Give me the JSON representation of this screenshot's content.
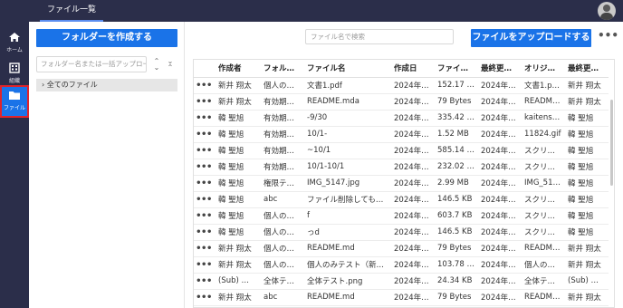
{
  "topbar": {
    "tab_label": "ファイル一覧"
  },
  "nav": {
    "items": [
      {
        "label": "ホーム",
        "icon": "home-icon"
      },
      {
        "label": "組織",
        "icon": "organization-icon"
      },
      {
        "label": "ファイル",
        "icon": "folder-icon",
        "active": true
      }
    ]
  },
  "folders": {
    "create_label": "フォルダーを作成する",
    "search_placeholder": "フォルダー名または一括アップロー",
    "tree_root": "全てのファイル"
  },
  "files": {
    "search_placeholder": "ファイル名で検索",
    "upload_label": "ファイルをアップロードする",
    "more_label": "•••",
    "columns": [
      "",
      "",
      "作成者",
      "フォル…",
      "ファイル名",
      "作成日",
      "ファイ…",
      "最終更…",
      "オリジ…",
      "最終更…"
    ],
    "rows": [
      [
        "•••",
        "",
        "新井 翔太",
        "個人の…",
        "文書1.pdf",
        "2024年…",
        "152.17 …",
        "2024年…",
        "文書1.p…",
        "新井 翔太"
      ],
      [
        "•••",
        "",
        "新井 翔太",
        "有効期…",
        "README.mda",
        "2024年…",
        "79 Bytes",
        "2024年…",
        "README…",
        "新井 翔太"
      ],
      [
        "•••",
        "",
        "韓 聖旭",
        "有効期…",
        "-9/30",
        "2024年…",
        "335.42 …",
        "2024年…",
        "kaitens…",
        "韓 聖旭"
      ],
      [
        "•••",
        "",
        "韓 聖旭",
        "有効期…",
        "10/1-",
        "2024年…",
        "1.52 MB",
        "2024年…",
        "11824.gif",
        "韓 聖旭"
      ],
      [
        "•••",
        "",
        "韓 聖旭",
        "有効期…",
        "~10/1",
        "2024年…",
        "585.14 …",
        "2024年…",
        "スクリ…",
        "韓 聖旭"
      ],
      [
        "•••",
        "",
        "韓 聖旭",
        "有効期…",
        "10/1-10/1",
        "2024年…",
        "232.02 …",
        "2024年…",
        "スクリ…",
        "韓 聖旭"
      ],
      [
        "•••",
        "",
        "韓 聖旭",
        "権限テ…",
        "IMG_5147.jpg",
        "2024年…",
        "2.99 MB",
        "2024年…",
        "IMG_51…",
        "韓 聖旭"
      ],
      [
        "•••",
        "",
        "韓 聖旭",
        "abc",
        "ファイル削除しても…",
        "2024年…",
        "146.5 KB",
        "2024年…",
        "スクリ…",
        "韓 聖旭"
      ],
      [
        "•••",
        "",
        "韓 聖旭",
        "個人の…",
        "f",
        "2024年…",
        "603.7 KB",
        "2024年…",
        "スクリ…",
        "韓 聖旭"
      ],
      [
        "•••",
        "",
        "韓 聖旭",
        "個人の…",
        "っd",
        "2024年…",
        "146.5 KB",
        "2024年…",
        "スクリ…",
        "韓 聖旭"
      ],
      [
        "•••",
        "",
        "新井 翔太",
        "個人の…",
        "README.md",
        "2024年…",
        "79 Bytes",
        "2024年…",
        "README…",
        "新井 翔太"
      ],
      [
        "•••",
        "",
        "新井 翔太",
        "個人の…",
        "個人のみテスト（新…",
        "2024年…",
        "103.78 …",
        "2024年…",
        "個人の…",
        "新井 翔太"
      ],
      [
        "•••",
        "",
        "(Sub) …",
        "全体テ…",
        "全体テスト.png",
        "2024年…",
        "24.34 KB",
        "2024年…",
        "全体テ…",
        "(Sub) …"
      ],
      [
        "•••",
        "",
        "新井 翔太",
        "abc",
        "README.md",
        "2024年…",
        "79 Bytes",
        "2024年…",
        "README…",
        "新井 翔太"
      ]
    ]
  }
}
